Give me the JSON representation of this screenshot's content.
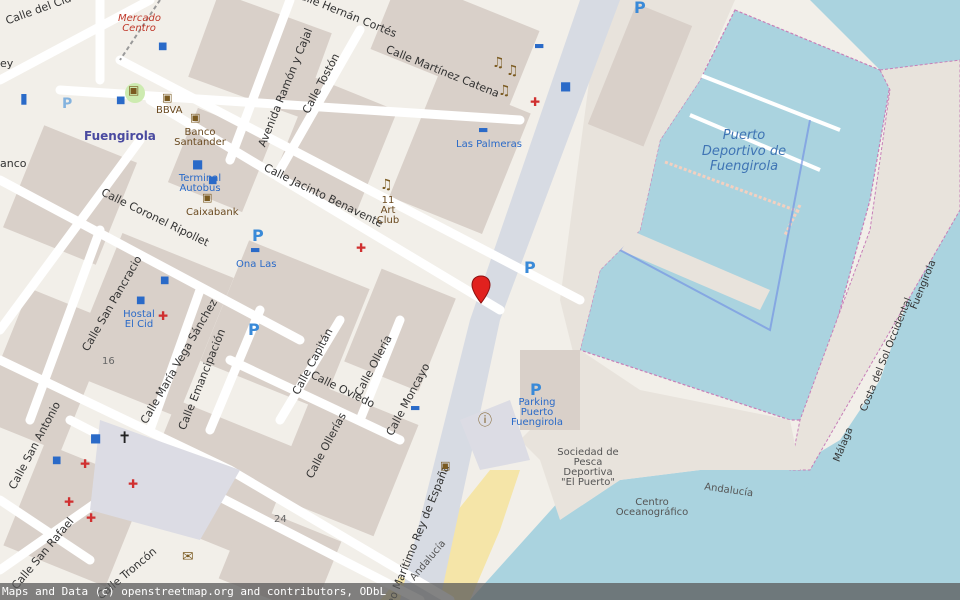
{
  "streets": {
    "del_cid": "Calle del Cid",
    "cortes": "Calle Hernán Cortés",
    "martinez_catena": "Calle Martínez Catena",
    "ramon_cajal": "Avenida Ramón y Cajal",
    "toston": "Calle Tostón",
    "jacinto_benavente": "Calle Jacinto Benavente",
    "coronel_ripollet": "Calle Coronel Ripollet",
    "san_pancracio": "Calle San Pancracio",
    "maria_vega": "Calle María Vega Sánchez",
    "emancipacion": "Calle Emancipación",
    "capitan": "Calle Capitán",
    "oviedo": "Calle Oviedo",
    "olleria": "Calle Ollería",
    "moncayo": "Calle Moncayo",
    "ollerias": "Calle Ollerías",
    "san_antonio": "Calle San Antonio",
    "san_rafael": "Calle San Rafael",
    "troncon": "Calle Troncón",
    "rey_espana": "Paseo Marítimo Rey de España",
    "costa_sol": "Costa del Sol Occidental",
    "fuengirola_rail": "Fuengirola",
    "malaga": "Málaga",
    "andalucia": "Andalucía",
    "andalucia_beach": "Andalucía"
  },
  "places": {
    "mercado": "Mercado Centro",
    "fuengirola": "Fuengirola",
    "bbva": "BBVA",
    "banco_santander": "Banco Santander",
    "terminal_autobus": "Terminal Autobus",
    "caixabank": "Caixabank",
    "las_palmeras": "Las Palmeras",
    "art_club": "11 Art Club",
    "ona_las": "Ona Las",
    "hostal_cid": "Hostal El Cid",
    "puerto_deportivo": "Puerto Deportivo de Fuengirola",
    "parking_puerto": "Parking Puerto Fuengirola",
    "sociedad_pesca": "Sociedad de Pesca Deportiva \"El Puerto\"",
    "centro_oceanografico": "Centro Oceanográfico",
    "house_16": "16",
    "house_24": "24",
    "stub_ancoa": "anco",
    "stub_ey": "ey"
  },
  "attribution": "Maps and Data (c) openstreetmap.org and contributors, ODbL",
  "marker_label": "map-marker",
  "colors": {
    "water": "#aad3df",
    "land": "#f2efe9",
    "building": "#d9d0c9",
    "road": "#ffffff",
    "primary_road": "#d7dbe3",
    "beach": "#f5e5a8",
    "marker": "#e1211e",
    "harbor_outline": "#c77fb8",
    "pier_outline": "#6c8ae4"
  },
  "icons": {
    "music": "music-note-icon",
    "hotel": "bed-icon",
    "parking": "parking-icon",
    "bus": "bus-icon",
    "pharmacy": "pharmacy-icon",
    "bank": "bank-icon",
    "church": "church-cross-icon",
    "info": "information-icon",
    "post": "envelope-icon",
    "marker": "map-pin-icon"
  }
}
